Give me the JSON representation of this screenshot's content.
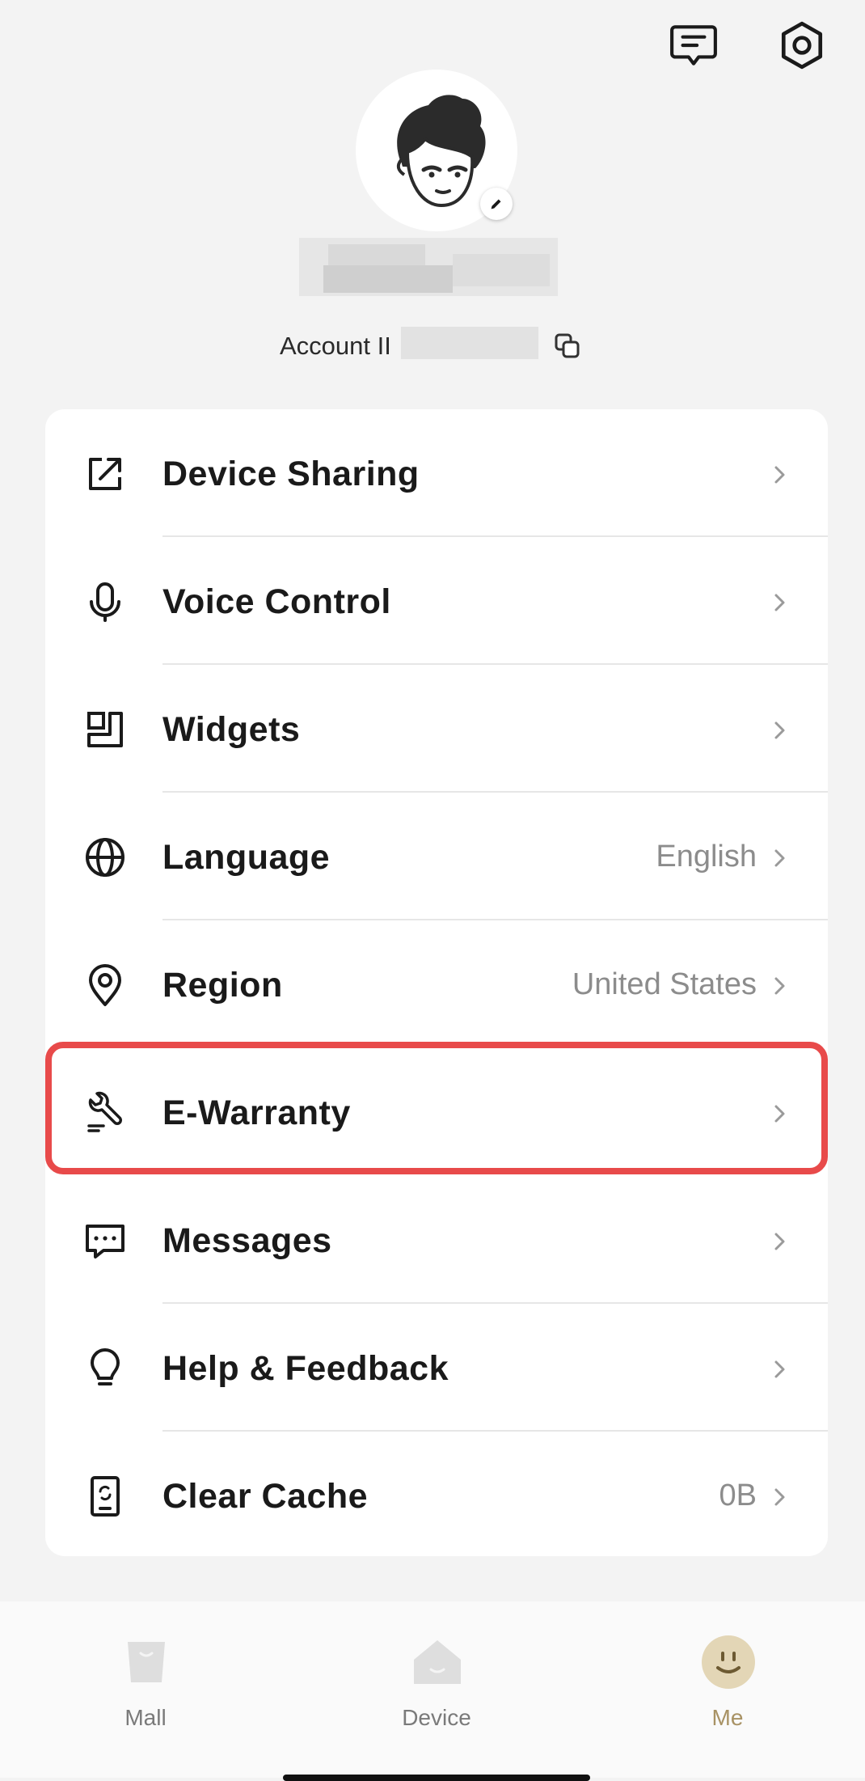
{
  "header": {
    "messages_icon": "message-square-icon",
    "settings_icon": "gear-icon"
  },
  "profile": {
    "account_label": "Account II",
    "avatar_icon": "cartoon-avatar",
    "edit_icon": "pencil-icon",
    "copy_icon": "copy-icon"
  },
  "menu": {
    "items": [
      {
        "label": "Device Sharing",
        "value": "",
        "icon": "share-external-icon"
      },
      {
        "label": "Voice Control",
        "value": "",
        "icon": "microphone-icon"
      },
      {
        "label": "Widgets",
        "value": "",
        "icon": "widgets-icon"
      },
      {
        "label": "Language",
        "value": "English",
        "icon": "globe-icon"
      },
      {
        "label": "Region",
        "value": "United States",
        "icon": "location-pin-icon"
      },
      {
        "label": "E-Warranty",
        "value": "",
        "icon": "wrench-icon"
      },
      {
        "label": "Messages",
        "value": "",
        "icon": "chat-bubble-icon"
      },
      {
        "label": "Help & Feedback",
        "value": "",
        "icon": "lightbulb-icon"
      },
      {
        "label": "Clear Cache",
        "value": "0B",
        "icon": "phone-refresh-icon"
      }
    ]
  },
  "tabbar": {
    "tabs": [
      {
        "label": "Mall",
        "active": false
      },
      {
        "label": "Device",
        "active": false
      },
      {
        "label": "Me",
        "active": true
      }
    ]
  },
  "colors": {
    "highlight": "#e84a4a",
    "active_tab": "#a89264"
  }
}
